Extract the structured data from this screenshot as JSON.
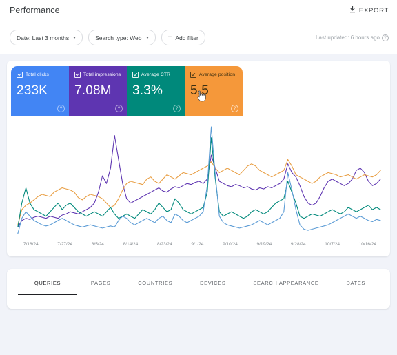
{
  "header": {
    "title": "Performance",
    "export_label": "EXPORT",
    "export_icon": "download-icon"
  },
  "filters": {
    "chips": [
      {
        "label": "Date: Last 3 months",
        "has_caret": true,
        "has_plus": false
      },
      {
        "label": "Search type: Web",
        "has_caret": true,
        "has_plus": false
      },
      {
        "label": "Add filter",
        "has_caret": false,
        "has_plus": true
      }
    ],
    "last_updated": "Last updated: 6 hours ago",
    "info_icon": "info-icon"
  },
  "metrics": [
    {
      "label": "Total clicks",
      "value": "233K",
      "color": "#4285f4",
      "dark_text": false,
      "help": "?"
    },
    {
      "label": "Total impressions",
      "value": "7.08M",
      "color": "#5e35b1",
      "dark_text": false,
      "help": "?"
    },
    {
      "label": "Average CTR",
      "value": "3.3%",
      "color": "#00897b",
      "dark_text": false,
      "help": "?"
    },
    {
      "label": "Average position",
      "value": "5.5",
      "color": "#f5983a",
      "dark_text": true,
      "help": "?"
    }
  ],
  "chart_data": {
    "type": "line",
    "title": "",
    "xlabel": "",
    "ylabel": "",
    "grid": false,
    "legend_position": "none",
    "x_tick_labels": [
      "7/18/24",
      "7/27/24",
      "8/5/24",
      "8/14/24",
      "8/23/24",
      "9/1/24",
      "9/10/24",
      "9/19/24",
      "9/28/24",
      "10/7/24",
      "10/16/24"
    ],
    "x_count": 91,
    "ylim": [
      0,
      100
    ],
    "series": [
      {
        "name": "Total impressions",
        "color": "#5e35b1",
        "values": [
          8,
          14,
          16,
          15,
          17,
          18,
          17,
          16,
          18,
          17,
          16,
          19,
          20,
          22,
          21,
          20,
          22,
          24,
          26,
          30,
          40,
          55,
          48,
          62,
          92,
          70,
          48,
          34,
          30,
          32,
          34,
          36,
          38,
          40,
          42,
          44,
          41,
          40,
          43,
          45,
          44,
          46,
          48,
          47,
          49,
          50,
          48,
          52,
          74,
          62,
          50,
          48,
          46,
          45,
          47,
          46,
          44,
          45,
          43,
          42,
          44,
          43,
          45,
          44,
          46,
          48,
          52,
          66,
          58,
          54,
          46,
          36,
          30,
          28,
          30,
          36,
          44,
          50,
          52,
          50,
          48,
          46,
          48,
          52,
          60,
          62,
          58,
          50,
          46,
          48,
          52
        ]
      },
      {
        "name": "Total clicks",
        "color": "#e89e43",
        "values": [
          10,
          24,
          28,
          30,
          33,
          36,
          38,
          37,
          36,
          40,
          42,
          44,
          43,
          42,
          40,
          35,
          33,
          36,
          38,
          37,
          36,
          34,
          30,
          26,
          28,
          34,
          42,
          48,
          50,
          49,
          48,
          47,
          52,
          54,
          50,
          48,
          52,
          56,
          54,
          52,
          55,
          58,
          57,
          56,
          58,
          60,
          62,
          64,
          68,
          62,
          58,
          60,
          62,
          60,
          58,
          56,
          60,
          64,
          66,
          64,
          60,
          58,
          56,
          54,
          56,
          58,
          60,
          70,
          64,
          56,
          54,
          52,
          50,
          48,
          50,
          54,
          56,
          58,
          57,
          56,
          54,
          55,
          56,
          54,
          52,
          54,
          56,
          55,
          54,
          56,
          60
        ]
      },
      {
        "name": "Average CTR",
        "color": "#00897b",
        "values": [
          8,
          30,
          44,
          30,
          24,
          22,
          20,
          18,
          22,
          26,
          30,
          24,
          28,
          30,
          26,
          22,
          20,
          18,
          20,
          22,
          20,
          18,
          22,
          26,
          20,
          16,
          18,
          20,
          18,
          16,
          20,
          24,
          22,
          20,
          24,
          30,
          26,
          22,
          24,
          34,
          30,
          24,
          22,
          20,
          22,
          24,
          26,
          40,
          90,
          52,
          22,
          18,
          20,
          22,
          20,
          18,
          16,
          18,
          22,
          24,
          22,
          20,
          22,
          26,
          30,
          32,
          34,
          50,
          40,
          30,
          18,
          16,
          18,
          20,
          19,
          18,
          20,
          22,
          24,
          22,
          20,
          22,
          26,
          24,
          22,
          24,
          26,
          28,
          24,
          26,
          24
        ]
      },
      {
        "name": "Average position",
        "color": "#5b9bd5",
        "values": [
          2,
          16,
          22,
          18,
          14,
          12,
          10,
          9,
          10,
          12,
          14,
          16,
          14,
          12,
          10,
          9,
          8,
          9,
          10,
          9,
          8,
          7,
          8,
          9,
          8,
          14,
          18,
          16,
          12,
          10,
          12,
          14,
          16,
          14,
          12,
          16,
          18,
          14,
          12,
          20,
          18,
          14,
          12,
          14,
          16,
          18,
          22,
          46,
          100,
          56,
          18,
          12,
          10,
          9,
          8,
          7,
          8,
          9,
          10,
          12,
          14,
          12,
          10,
          12,
          14,
          16,
          22,
          58,
          42,
          24,
          10,
          6,
          5,
          6,
          7,
          8,
          9,
          10,
          12,
          14,
          16,
          18,
          20,
          18,
          16,
          18,
          16,
          14,
          13,
          15,
          14
        ]
      }
    ]
  },
  "tabs": [
    {
      "label": "QUERIES",
      "active": true
    },
    {
      "label": "PAGES",
      "active": false
    },
    {
      "label": "COUNTRIES",
      "active": false
    },
    {
      "label": "DEVICES",
      "active": false
    },
    {
      "label": "SEARCH APPEARANCE",
      "active": false
    },
    {
      "label": "DATES",
      "active": false
    }
  ]
}
